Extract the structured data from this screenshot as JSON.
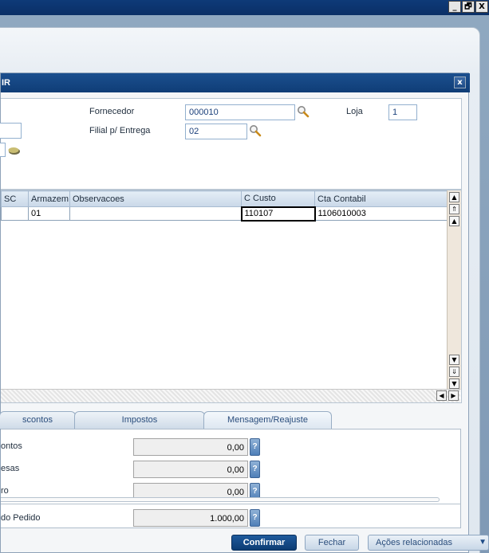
{
  "window": {
    "minimize": "_",
    "restore": "🗗",
    "close": "X"
  },
  "dialog": {
    "title": "IR",
    "close": "x"
  },
  "form": {
    "fornecedor_label": "Fornecedor",
    "fornecedor_value": "000010",
    "loja_label": "Loja",
    "loja_value": "1",
    "filial_label": "Filial p/ Entrega",
    "filial_value": "02",
    "left_field_value": ""
  },
  "grid": {
    "columns": [
      "SC",
      "Armazem",
      "Observacoes",
      "C Custo",
      "Cta Contabil"
    ],
    "rows": [
      [
        "",
        "01",
        "",
        "110107",
        "1106010003"
      ]
    ]
  },
  "tabs": [
    "scontos",
    "Impostos",
    "Mensagem/Reajuste"
  ],
  "totals": [
    {
      "label": "ontos",
      "value": "0,00"
    },
    {
      "label": "esas",
      "value": "0,00"
    },
    {
      "label": "ro",
      "value": "0,00"
    },
    {
      "label": "do Pedido",
      "value": "1.000,00"
    }
  ],
  "help_glyph": "?",
  "buttons": {
    "confirm": "Confirmar",
    "close": "Fechar",
    "actions": "Ações relacionadas"
  },
  "colors": {
    "accent": "#0f3d77",
    "header_bg": "#1b4f8f"
  }
}
